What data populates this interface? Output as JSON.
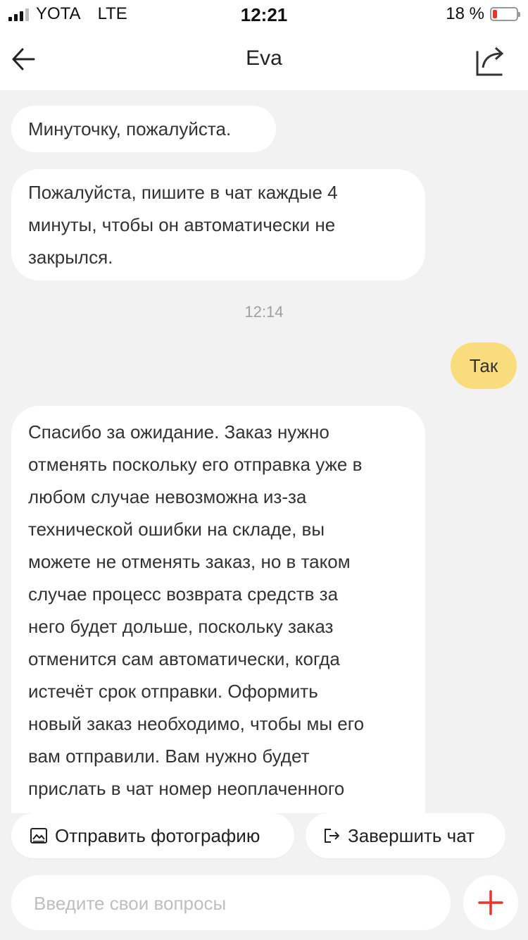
{
  "status_bar": {
    "carrier": "YOTA",
    "network": "LTE",
    "time": "12:21",
    "battery_percent": "18 %",
    "battery_level": 0.18,
    "battery_color": "#e8342a"
  },
  "header": {
    "title": "Eva",
    "back_icon": "arrow-left-icon",
    "share_icon": "share-icon"
  },
  "messages": [
    {
      "from": "agent",
      "text": "Минуточку, пожалуйста."
    },
    {
      "from": "agent",
      "text": "Пожалуйста, пишите в чат каждые 4\nминуты, чтобы он автоматически не\nзакрылся."
    },
    {
      "from": "system",
      "text": "12:14"
    },
    {
      "from": "user",
      "text": "Так"
    },
    {
      "from": "agent",
      "text": "Спасибо за ожидание. Заказ нужно\nотменять поскольку его отправка уже в\nлюбом случае невозможна из-за\nтехнической ошибки на складе, вы\nможете не отменять заказ, но в таком\nслучае процесс возврата средств за\nнего будет дольше, поскольку заказ\nотменится сам автоматически, когда\nистечёт срок отправки. Оформить\nновый заказ необходимо, чтобы мы его\nвам отправили. Вам нужно будет\nприслать в чат номер неоплаченного"
    }
  ],
  "actions": {
    "send_photo": "Отправить фотографию",
    "end_chat": "Завершить чат"
  },
  "composer": {
    "placeholder": "Введите свои вопросы",
    "value": ""
  },
  "colors": {
    "user_bubble": "#f9dc7c",
    "accent_plus": "#e8342a",
    "background": "#f2f2f2"
  }
}
